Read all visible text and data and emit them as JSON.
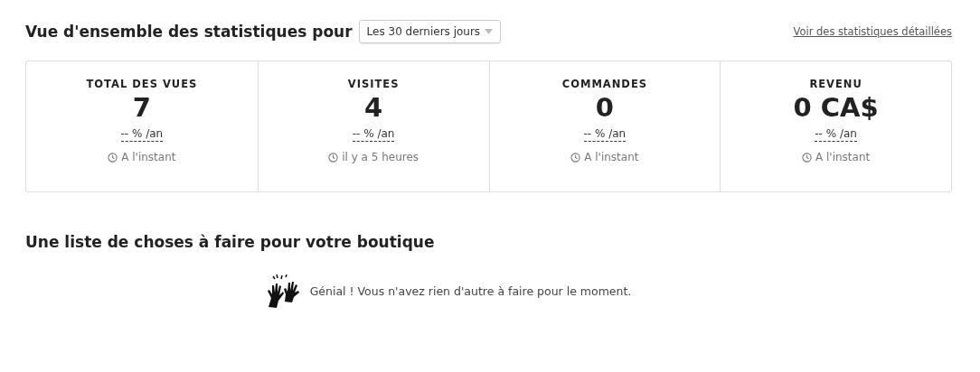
{
  "header": {
    "title": "Vue d'ensemble des statistiques pour",
    "period_select": {
      "value": "Les 30 derniers jours"
    },
    "details_link": "Voir des statistiques détaillées"
  },
  "stats": [
    {
      "label": "TOTAL DES VUES",
      "value": "7",
      "change": "-- % /an",
      "updated": "A l'instant"
    },
    {
      "label": "VISITES",
      "value": "4",
      "change": "-- % /an",
      "updated": "il y a 5 heures"
    },
    {
      "label": "COMMANDES",
      "value": "0",
      "change": "-- % /an",
      "updated": "A l'instant"
    },
    {
      "label": "REVENU",
      "value": "0 CA$",
      "change": "-- % /an",
      "updated": "A l'instant"
    }
  ],
  "todo": {
    "title": "Une liste de choses à faire pour votre boutique",
    "message": "Génial ! Vous n'avez rien d'autre à faire pour le moment."
  }
}
